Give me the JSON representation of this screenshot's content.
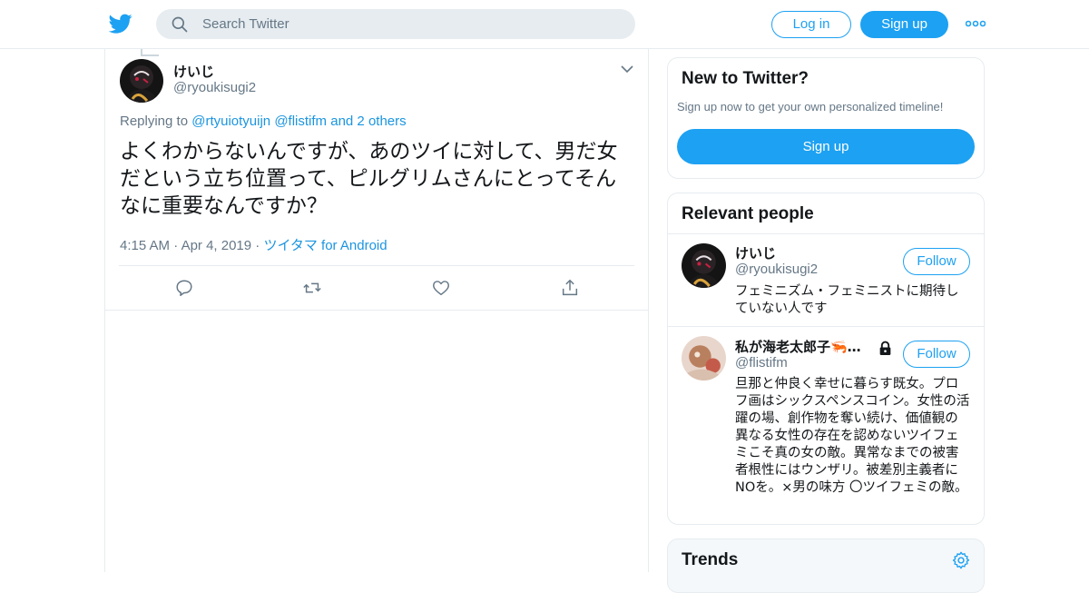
{
  "header": {
    "search_placeholder": "Search Twitter",
    "login_label": "Log in",
    "signup_label": "Sign up",
    "icons": [
      "twitter-bird-icon",
      "search-icon",
      "more-dots-icon"
    ]
  },
  "tweet": {
    "name": "けいじ",
    "handle": "@ryoukisugi2",
    "replying_prefix": "Replying to",
    "replying_user1": "@rtyuiotyuijn",
    "replying_user2": "@flistifm",
    "replying_others": "and 2 others",
    "text": "よくわからないんですが、あのツイに対して、男だ女だという立ち位置って、ピルグリムさんにとってそんなに重要なんですか？",
    "time": "4:15 AM",
    "date": "Apr 4, 2019",
    "source": "ツイタマ for Android",
    "actions": [
      "reply-icon",
      "retweet-icon",
      "like-icon",
      "share-icon"
    ]
  },
  "sidebar": {
    "new_to_twitter": {
      "title": "New to Twitter?",
      "subtitle": "Sign up now to get your own personalized timeline!",
      "button": "Sign up"
    },
    "relevant_people": {
      "title": "Relevant people",
      "people": [
        {
          "name": "けいじ",
          "handle": "@ryoukisugi2",
          "bio": "フェミニズム・フェミニストに期待していない人です",
          "follow_label": "Follow"
        },
        {
          "name": "私が海老太郎子🦐…",
          "handle": "@flistifm",
          "bio": "旦那と仲良く幸せに暮らす既女。プロフ画はシックスペンスコイン。女性の活躍の場、創作物を奪い続け、価値観の異なる女性の存在を認めないツイフェミこそ真の女の敵。異常なまでの被害者根性にはウンザリ。被差別主義者にNOを。×男の味方 〇ツイフェミの敵。",
          "follow_label": "Follow",
          "protected": true
        }
      ]
    },
    "trends": {
      "title": "Trends"
    }
  },
  "colors": {
    "accent": "#1da1f2",
    "link": "#1b95e0",
    "secondary_text": "#657786",
    "border": "#e6ecf0"
  }
}
